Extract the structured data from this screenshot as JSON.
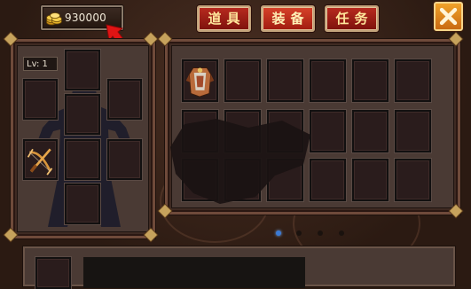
{
  "header": {
    "gold_amount": "930000",
    "coin_icon": "gold-coins-icon",
    "arrow_icon": "red-arrow-icon",
    "tabs": [
      {
        "label": "道具",
        "active": false
      },
      {
        "label": "装备",
        "active": true
      },
      {
        "label": "任务",
        "active": false
      }
    ],
    "close_icon": "close-icon"
  },
  "equipment": {
    "level_label": "Lv: 1",
    "equipped_weapon_icon": "crossbow-icon"
  },
  "inventory": {
    "first_item_icon": "armor-icon"
  },
  "pagination": {
    "total_pages": 4,
    "current_page": 1
  },
  "colors": {
    "tab_red": "#b82a1f",
    "tab_text": "#ffe79c",
    "close_orange": "#f0a22a",
    "frame_gold": "#c6a25c",
    "active_dot": "#3a7ad6"
  }
}
